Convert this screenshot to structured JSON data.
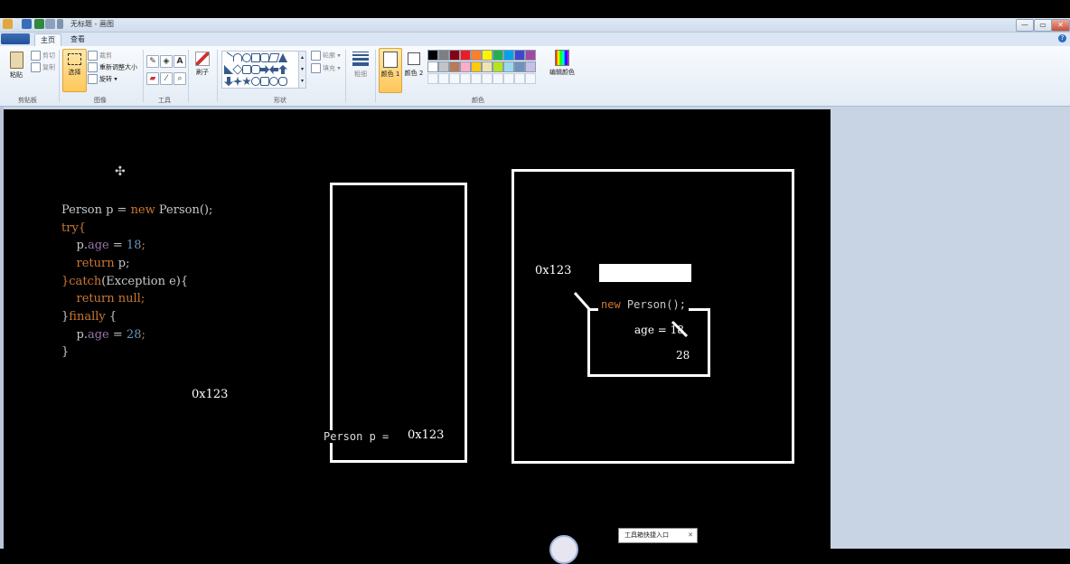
{
  "window": {
    "title": "无标题 - 画图",
    "controls": {
      "minimize": "—",
      "maximize": "▭",
      "close": "✕"
    }
  },
  "tabs": {
    "home": "主页",
    "view": "查看"
  },
  "ribbon": {
    "clipboard": {
      "label": "剪贴板",
      "paste": "粘贴",
      "cut": "剪切",
      "copy": "复制"
    },
    "image": {
      "label": "图像",
      "select": "选择",
      "crop": "裁剪",
      "resize": "重新调整大小",
      "rotate": "旋转"
    },
    "tools": {
      "label": "工具"
    },
    "brushes": {
      "label": "刷子"
    },
    "shapes": {
      "label": "形状",
      "outline": "轮廓",
      "fill": "填充"
    },
    "size": {
      "label": "粗细"
    },
    "color1": "颜色 1",
    "color2": "颜色 2",
    "colors": {
      "label": "颜色",
      "edit": "编辑颜色"
    },
    "palette": [
      "#000000",
      "#7f7f7f",
      "#880015",
      "#ed1c24",
      "#ff7f27",
      "#fff200",
      "#22b14c",
      "#00a2e8",
      "#3f48cc",
      "#a349a4",
      "#ffffff",
      "#c3c3c3",
      "#b97a57",
      "#ffaec9",
      "#ffc90e",
      "#efe4b0",
      "#b5e61d",
      "#99d9ea",
      "#7092be",
      "#c8bfe7"
    ]
  },
  "code": {
    "line1_a": "Person p = ",
    "line1_new": "new",
    "line1_b": " Person();",
    "line2": "try{",
    "line3_a": "    p.",
    "line3_age": "age",
    "line3_b": " = ",
    "line3_num": "18",
    "line3_c": ";",
    "line4_ret": "    return",
    "line4_b": " p;",
    "line5_a": "}",
    "line5_catch": "catch",
    "line5_b": "(Exception e){",
    "line6_ret": "    return",
    "line6_null": " null",
    "line6_c": ";",
    "line7_a": "}",
    "line7_finally": "finally",
    "line7_b": " {",
    "line8_a": "    p.",
    "line8_age": "age",
    "line8_b": " = ",
    "line8_num": "28",
    "line8_c": ";",
    "line9": "}"
  },
  "diagram": {
    "addr_left": "0x123",
    "stack_label": "Person p =",
    "stack_value": "0x123",
    "heap_addr": "0x123",
    "heap_new": "new",
    "heap_ctor": " Person();",
    "heap_age": "age = 18",
    "heap_age_new": "28"
  },
  "tooltip": {
    "text": "工具箱快捷入口",
    "close": "✕"
  },
  "colors": {
    "code_default": "#c9c9c9",
    "keyword": "#cc7832",
    "number": "#6897bb",
    "field": "#9876aa",
    "canvas": "#000000"
  }
}
